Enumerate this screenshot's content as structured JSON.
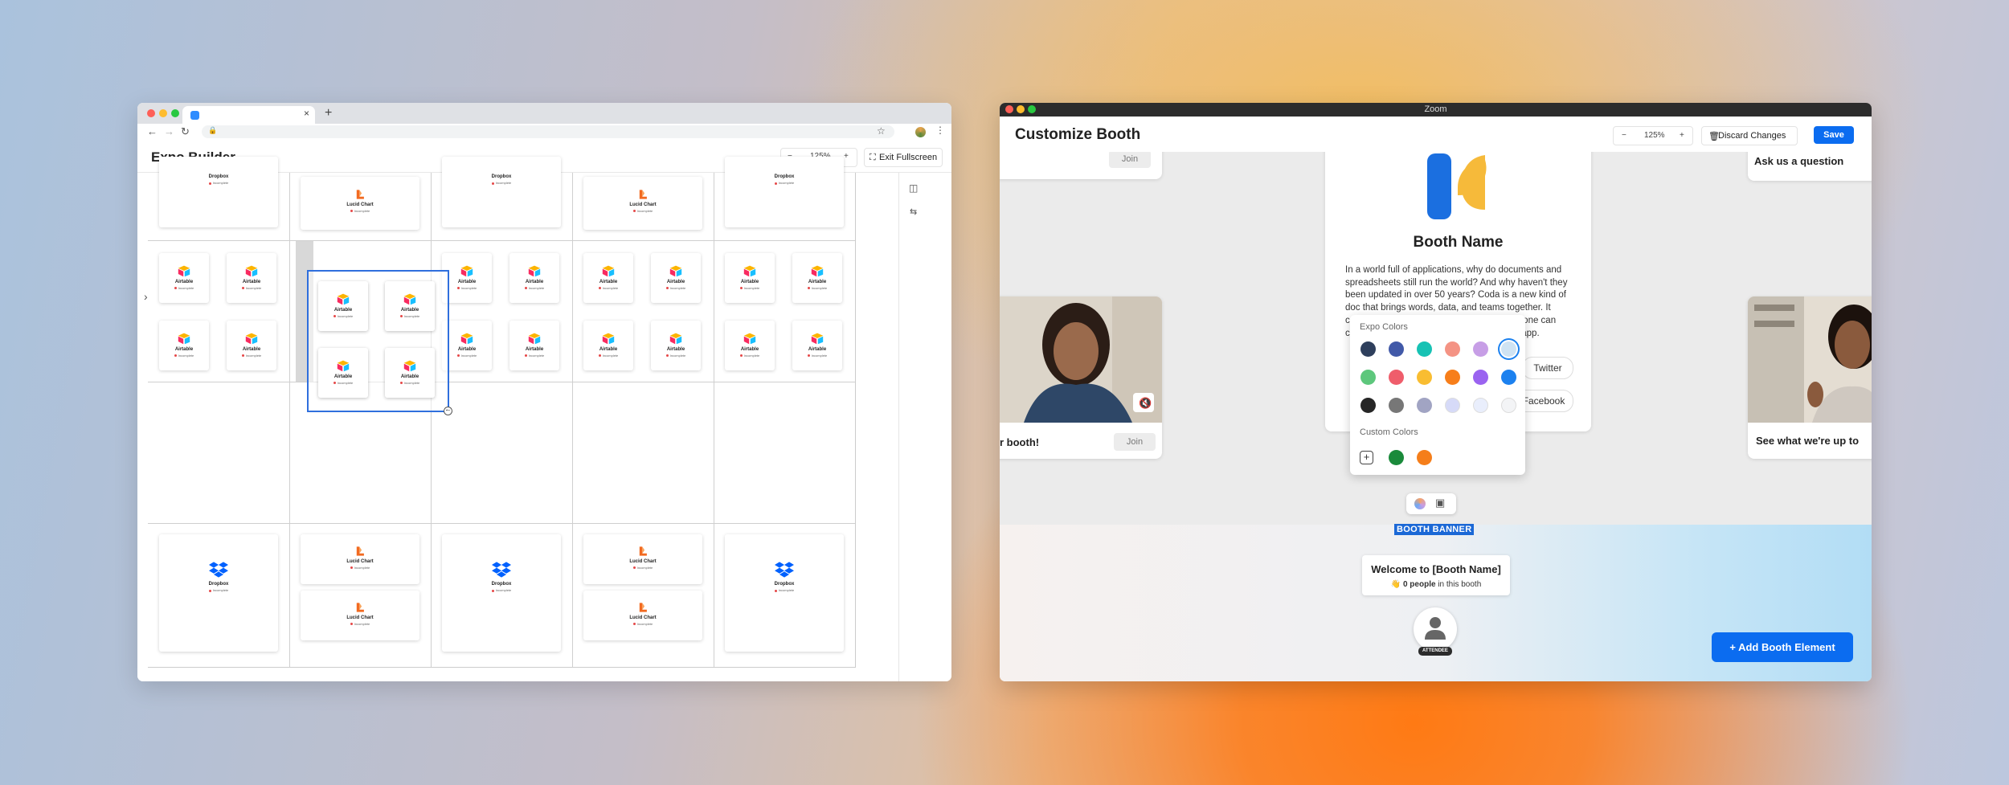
{
  "left_window": {
    "tab_close": "×",
    "new_tab": "+",
    "nav": {
      "back": "←",
      "forward": "→",
      "reload": "↻"
    },
    "app_title": "Expo Builder",
    "zoom": {
      "minus": "−",
      "value": "125%",
      "plus": "+"
    },
    "exit_fullscreen_label": "Exit Fullscreen",
    "cards": {
      "dropbox": {
        "name": "Dropbox",
        "sub": "Incomplete"
      },
      "lucid": {
        "name": "Lucid Chart",
        "sub": "Incomplete"
      },
      "airtable": {
        "name": "Airtable",
        "sub": "Incomplete"
      }
    }
  },
  "right_window": {
    "os_title": "Zoom",
    "page_title": "Customize Booth",
    "zoom": {
      "minus": "−",
      "value": "125%",
      "plus": "+"
    },
    "discard_label": "Discard Changes",
    "save_label": "Save",
    "join_label": "Join",
    "booth_name": "Booth Name",
    "description": "In a world full of applications, why do documents and spreadsheets still run the world? And why haven't they been updated in over 50 years? Coda is a new kind of doc that brings words, data, and teams together. It comes with a set of building blocks that anyone can combine to create a doc as powerful as an app.",
    "twitter_label": "Twitter",
    "facebook_label": "Facebook",
    "left_card_caption": "r booth!",
    "right_top_caption": "Ask us a question",
    "right_card_caption": "See what we're up to",
    "palette": {
      "expo_colors_label": "Expo Colors",
      "custom_colors_label": "Custom Colors",
      "expo_colors": [
        "#2e3f5c",
        "#4159a8",
        "#17c2b4",
        "#f49384",
        "#c79ee6",
        "#cfe3f3",
        "#5dc77c",
        "#ef5d6b",
        "#f9bd31",
        "#f77e1a",
        "#9a63f0",
        "#1c81ef",
        "#262626",
        "#777777",
        "#a1a4c3",
        "#d6daf8",
        "#e9eefc",
        "#f3f4f6"
      ],
      "custom_colors": [
        "#1a8a3b",
        "#f57e1a"
      ]
    },
    "banner_label": "BOOTH BANNER",
    "welcome_title": "Welcome to [Booth Name]",
    "welcome_count": "0 people",
    "welcome_suffix": " in this booth",
    "attendee_label": "ATTENDEE",
    "add_element_label": "Add Booth Element"
  }
}
